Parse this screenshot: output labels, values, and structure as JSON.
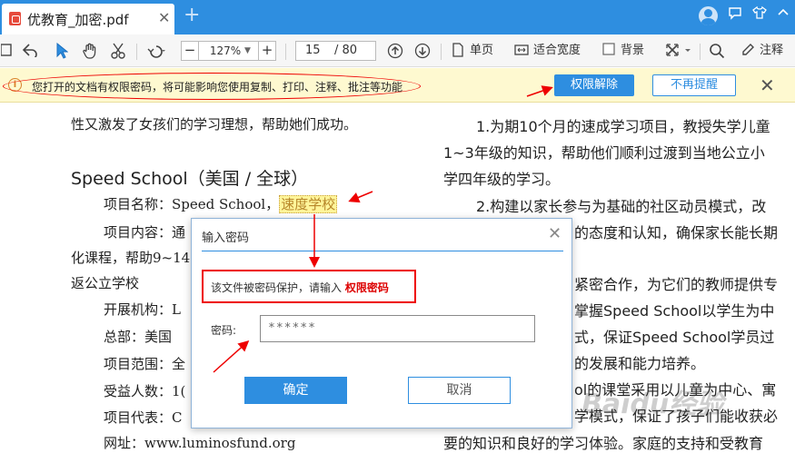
{
  "titlebar": {
    "tab_title": "优教育_加密.pdf",
    "tab_close": "✕",
    "new_tab": "+",
    "user_icon": "user-avatar-icon",
    "controls": [
      "comment-icon",
      "shirt-skin-icon",
      "collapse-icon"
    ]
  },
  "toolbar": {
    "zoom_minus": "−",
    "zoom_value": "127%",
    "zoom_plus": "+",
    "page_current": "15",
    "page_total": "/ 80",
    "single_page": "单页",
    "fit_width": "适合宽度",
    "background": "背景",
    "annotate": "注释"
  },
  "notice": {
    "message": "您打开的文档有权限密码，将可能影响您使用复制、打印、注释、批注等功能",
    "unlock_button": "权限解除",
    "no_remind_button": "不再提醒",
    "close": "✕"
  },
  "document": {
    "left": {
      "l1": "性又激发了女孩们的学习理想，帮助她们成功。",
      "heading": "Speed School（美国 / 全球）",
      "name_label": "项目名称：Speed School，",
      "name_highlight": "速度学校",
      "content_label": "项目内容：通",
      "l_course": "化课程，帮助9~14",
      "l_return": "返公立学校",
      "org": "开展机构：L",
      "hq": "总部：美国",
      "scope": "项目范围：全",
      "beneficiaries": "受益人数：1(",
      "rep": "项目代表：C",
      "url": "网址：www.luminosfund.org"
    },
    "right": {
      "r1": "1.为期10个月的速成学习项目，教授失学儿童",
      "r2": "1~3年级的知识，帮助他们顺利过渡到当地公立小",
      "r3": "学四年级的学习。",
      "r4": "2.构建以家长参与为基础的社区动员模式，改",
      "r5": "的态度和认知，确保家长能长期",
      "r6": "紧密合作，为它们的教师提供专",
      "r7": "掌握Speed School以学生为中",
      "r8": "式，保证Speed School学员过",
      "r9": "的发展和能力培养。",
      "r10": "ol的课堂采用以儿童为中心、寓",
      "r11": "学模式，保证了孩子们能收获必",
      "r12": "要的知识和良好的学习体验。家庭的支持和受教育"
    }
  },
  "dialog": {
    "title": "输入密码",
    "close": "✕",
    "message": "该文件被密码保护，请输入 ",
    "message_red": "权限密码",
    "password_label": "密码:",
    "password_value": "******",
    "ok": "确定",
    "cancel": "取消"
  },
  "watermark": "Baidu经验",
  "colors": {
    "accent": "#2e8ee0",
    "notice_bg": "#fef9d0",
    "annotation_red": "#e00000"
  }
}
